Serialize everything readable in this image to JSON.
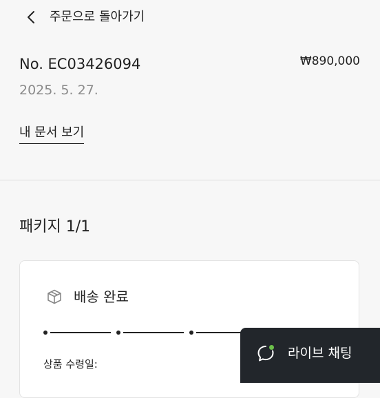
{
  "header": {
    "back_label": "주문으로 돌아가기"
  },
  "order": {
    "number": "No. EC03426094",
    "total": "₩890,000",
    "date": "2025. 5. 27.",
    "documents_link": "내 문서 보기"
  },
  "package": {
    "title": "패키지 1/1",
    "status": "배송 완료",
    "receipt_label": "상품 수령일:",
    "progress_steps": 4,
    "progress_completed": 4
  },
  "chat": {
    "label": "라이브 채팅",
    "status_color": "#6cc04a"
  },
  "colors": {
    "background": "#f7f7f7",
    "card": "#ffffff",
    "chat_button": "#22262b",
    "muted_text": "#8a8a8a"
  },
  "icons": {
    "back": "chevron-left-icon",
    "status": "package-box-icon",
    "chat": "chat-bubble-icon"
  }
}
